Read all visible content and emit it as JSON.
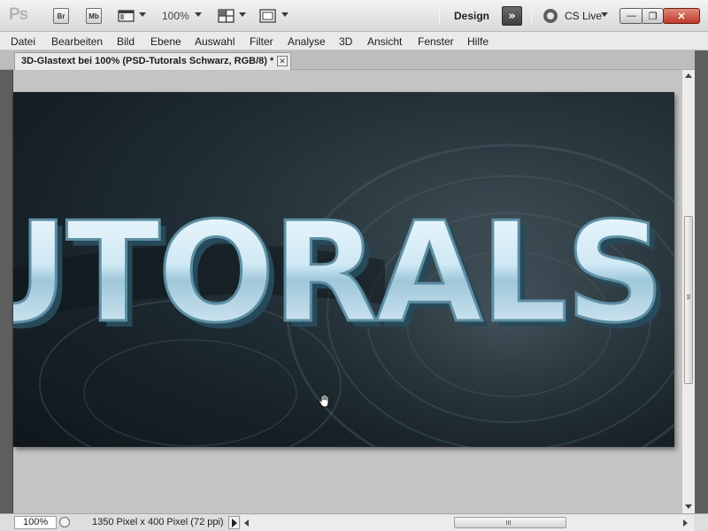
{
  "app": {
    "logo": "Ps",
    "bridge_label": "Br",
    "minibridge_label": "Mb",
    "zoom_value": "100%",
    "workspace_label": "Design",
    "extend_label": "»",
    "cslive_label": "CS Live",
    "icons": [
      "frame-icon",
      "arrange-docs-icon",
      "screen-mode-icon",
      "cs-live-icon",
      "hand-cursor-icon"
    ]
  },
  "window_controls": {
    "minimize": "—",
    "restore": "❐",
    "close": "✕"
  },
  "menu": {
    "items": [
      "Datei",
      "Bearbeiten",
      "Bild",
      "Ebene",
      "Auswahl",
      "Filter",
      "Analyse",
      "3D",
      "Ansicht",
      "Fenster",
      "Hilfe"
    ]
  },
  "document": {
    "tab_title": "3D-Glastext bei 100% (PSD-Tutorals Schwarz, RGB/8) *",
    "close_glyph": "✕",
    "canvas_text": "UTORALS"
  },
  "status": {
    "zoom": "100%",
    "doc_info": "1350 Pixel x 400 Pixel (72 ppi)"
  },
  "colors": {
    "canvas_dark": "#162127",
    "glass_text_fill": "#d9eef6",
    "glass_text_edge": "#3f6f85",
    "chrome_light": "#ececec",
    "chrome_dark": "#5e5e5e",
    "close_red": "#c0382a"
  }
}
